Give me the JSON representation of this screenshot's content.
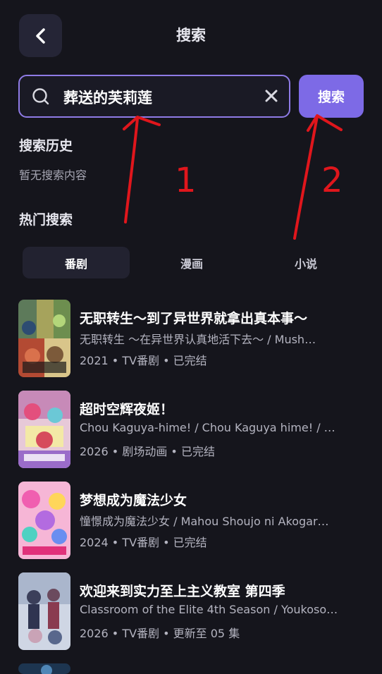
{
  "header": {
    "back_icon": "chevron-left-icon",
    "title": "搜索"
  },
  "search": {
    "value": "葬送的芙莉莲",
    "search_icon": "search-icon",
    "clear_icon": "close-icon",
    "button_label": "搜索"
  },
  "history": {
    "title": "搜索历史",
    "empty_text": "暂无搜索内容"
  },
  "hot": {
    "title": "热门搜索",
    "tabs": [
      {
        "label": "番剧",
        "active": true
      },
      {
        "label": "漫画",
        "active": false
      },
      {
        "label": "小说",
        "active": false
      }
    ]
  },
  "results": [
    {
      "title": "无职转生～到了异世界就拿出真本事～",
      "alt": "无职转生 ～在异世界认真地活下去～ / Mush…",
      "meta": "2021 • TV番剧 • 已完结"
    },
    {
      "title": "超时空辉夜姬！",
      "alt": "Chou Kaguya-hime! / Chou Kaguya hime! / …",
      "meta": "2026 • 剧场动画 • 已完结"
    },
    {
      "title": "梦想成为魔法少女",
      "alt": "憧憬成为魔法少女 / Mahou Shoujo ni Akogar…",
      "meta": "2024 • TV番剧 • 已完结"
    },
    {
      "title": "欢迎来到实力至上主义教室 第四季",
      "alt": "Classroom of the Elite 4th Season / Youkoso…",
      "meta": "2026 • TV番剧 • 更新至 05 集"
    }
  ],
  "annotations": {
    "label_1": "1",
    "label_2": "2",
    "color": "#e0161c"
  },
  "colors": {
    "background": "#15151c",
    "accent": "#7d6ae6",
    "search_border": "#8f7be6"
  }
}
